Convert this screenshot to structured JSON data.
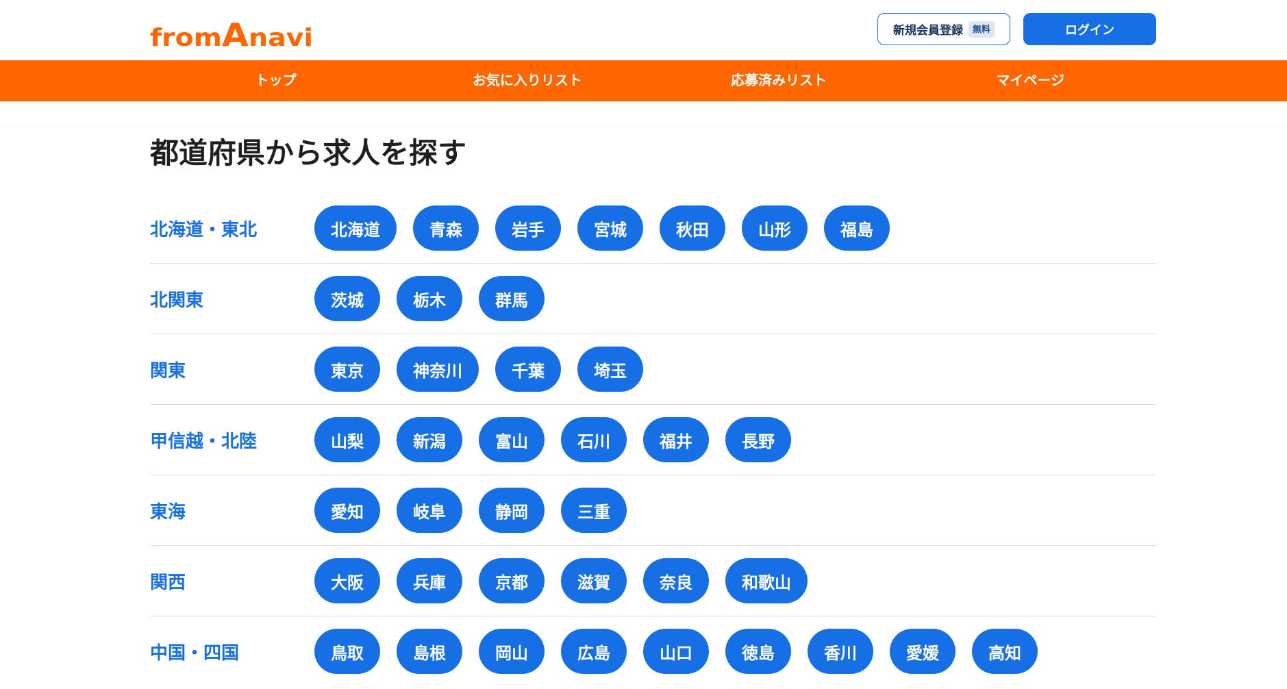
{
  "colors": {
    "brand_orange": "#ff6600",
    "accent_blue": "#176fe6"
  },
  "header": {
    "logo": {
      "from": "from",
      "a": "A",
      "navi": "navi"
    },
    "register_label": "新規会員登録",
    "register_badge": "無料",
    "login_label": "ログイン"
  },
  "nav": {
    "items": [
      {
        "label": "トップ"
      },
      {
        "label": "お気に入りリスト"
      },
      {
        "label": "応募済みリスト"
      },
      {
        "label": "マイページ"
      }
    ]
  },
  "main": {
    "title": "都道府県から求人を探す",
    "regions": [
      {
        "name": "北海道・東北",
        "prefectures": [
          "北海道",
          "青森",
          "岩手",
          "宮城",
          "秋田",
          "山形",
          "福島"
        ]
      },
      {
        "name": "北関東",
        "prefectures": [
          "茨城",
          "栃木",
          "群馬"
        ]
      },
      {
        "name": "関東",
        "prefectures": [
          "東京",
          "神奈川",
          "千葉",
          "埼玉"
        ]
      },
      {
        "name": "甲信越・北陸",
        "prefectures": [
          "山梨",
          "新潟",
          "富山",
          "石川",
          "福井",
          "長野"
        ]
      },
      {
        "name": "東海",
        "prefectures": [
          "愛知",
          "岐阜",
          "静岡",
          "三重"
        ]
      },
      {
        "name": "関西",
        "prefectures": [
          "大阪",
          "兵庫",
          "京都",
          "滋賀",
          "奈良",
          "和歌山"
        ]
      },
      {
        "name": "中国・四国",
        "prefectures": [
          "鳥取",
          "島根",
          "岡山",
          "広島",
          "山口",
          "徳島",
          "香川",
          "愛媛",
          "高知"
        ]
      }
    ]
  }
}
